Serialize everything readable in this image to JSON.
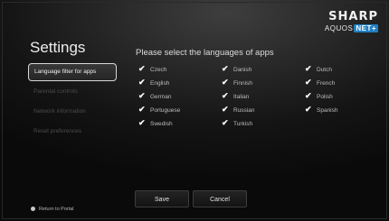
{
  "header": {
    "brand": "SHARP",
    "product": "AQUOS",
    "product_badge": "NET+"
  },
  "page": {
    "title": "Settings",
    "prompt": "Please select the languages of apps"
  },
  "sidebar": {
    "items": [
      {
        "label": "Language filter for apps",
        "selected": true
      },
      {
        "label": "Parental controls",
        "selected": false
      },
      {
        "label": "Network information",
        "selected": false
      },
      {
        "label": "Reset preferences",
        "selected": false
      }
    ]
  },
  "languages": [
    {
      "label": "Czech",
      "checked": true
    },
    {
      "label": "English",
      "checked": true
    },
    {
      "label": "German",
      "checked": true
    },
    {
      "label": "Portuguese",
      "checked": true
    },
    {
      "label": "Swedish",
      "checked": true
    },
    {
      "label": "Danish",
      "checked": true
    },
    {
      "label": "Finnish",
      "checked": true
    },
    {
      "label": "Italian",
      "checked": true
    },
    {
      "label": "Russian",
      "checked": true
    },
    {
      "label": "Turkish",
      "checked": true
    },
    {
      "label": "Dutch",
      "checked": true
    },
    {
      "label": "French",
      "checked": true
    },
    {
      "label": "Polish",
      "checked": true
    },
    {
      "label": "Spanish",
      "checked": true
    }
  ],
  "buttons": {
    "save": "Save",
    "cancel": "Cancel"
  },
  "footer": {
    "return_label": "Return to Portal"
  },
  "colors": {
    "badge": "#1f7fc2",
    "selected_border": "#d8d8d8"
  }
}
